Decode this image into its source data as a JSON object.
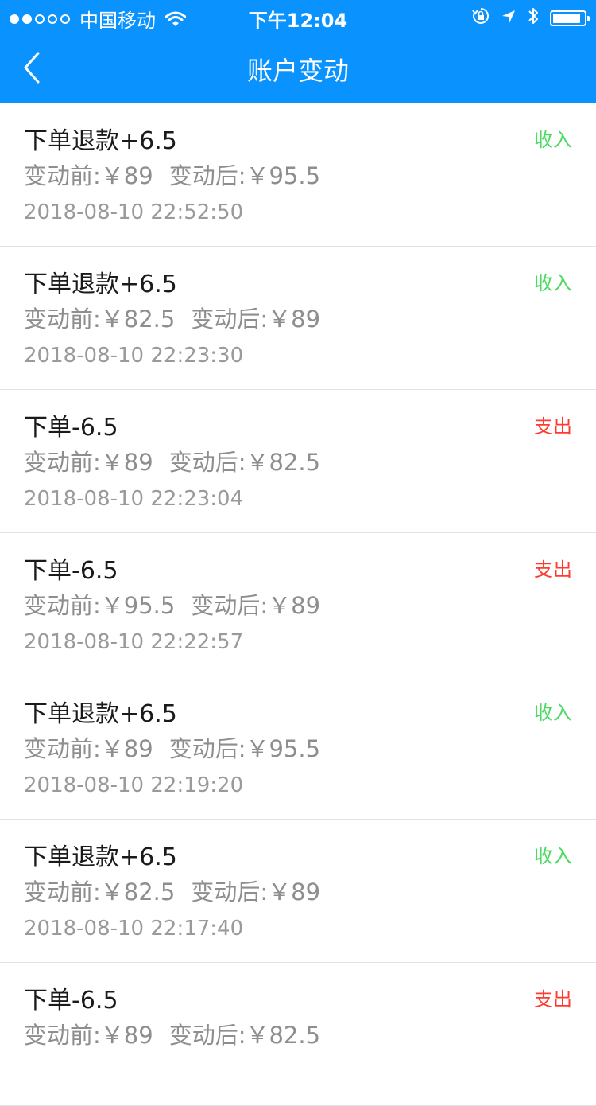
{
  "status_bar": {
    "carrier": "中国移动",
    "time": "下午12:04",
    "signal_filled": 2,
    "signal_total": 5,
    "battery_level": 0.9
  },
  "nav": {
    "title": "账户变动",
    "back_icon": "chevron-left-icon"
  },
  "colors": {
    "header": "#0a93ff",
    "income": "#4cd964",
    "expense": "#ff3b30"
  },
  "records": [
    {
      "title": "下单退款+6.5",
      "before": "变动前:￥89",
      "after": "变动后:￥95.5",
      "time": "2018-08-10 22:52:50",
      "type": "收入",
      "kind": "income"
    },
    {
      "title": "下单退款+6.5",
      "before": "变动前:￥82.5",
      "after": "变动后:￥89",
      "time": "2018-08-10 22:23:30",
      "type": "收入",
      "kind": "income"
    },
    {
      "title": "下单-6.5",
      "before": "变动前:￥89",
      "after": "变动后:￥82.5",
      "time": "2018-08-10 22:23:04",
      "type": "支出",
      "kind": "expense"
    },
    {
      "title": "下单-6.5",
      "before": "变动前:￥95.5",
      "after": "变动后:￥89",
      "time": "2018-08-10 22:22:57",
      "type": "支出",
      "kind": "expense"
    },
    {
      "title": "下单退款+6.5",
      "before": "变动前:￥89",
      "after": "变动后:￥95.5",
      "time": "2018-08-10 22:19:20",
      "type": "收入",
      "kind": "income"
    },
    {
      "title": "下单退款+6.5",
      "before": "变动前:￥82.5",
      "after": "变动后:￥89",
      "time": "2018-08-10 22:17:40",
      "type": "收入",
      "kind": "income"
    },
    {
      "title": "下单-6.5",
      "before": "变动前:￥89",
      "after": "变动后:￥82.5",
      "time": "",
      "type": "支出",
      "kind": "expense"
    }
  ]
}
